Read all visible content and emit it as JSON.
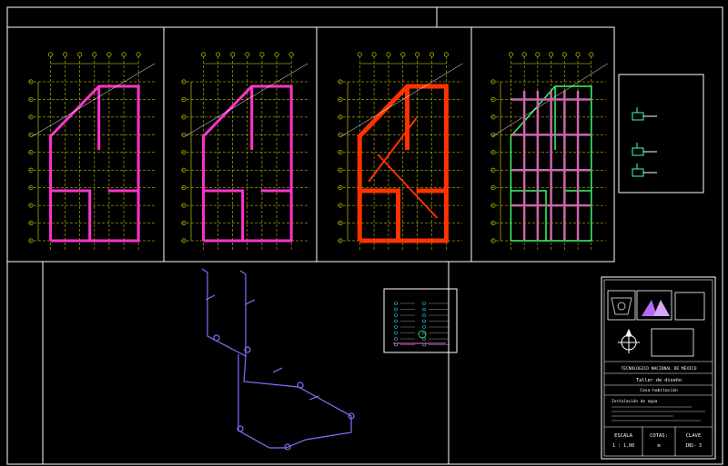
{
  "drawing": {
    "header_title": "",
    "panel_labels": [
      "",
      "",
      "",
      ""
    ],
    "detail_title": "",
    "legend_title": ""
  },
  "title_block": {
    "institution": "TECNOLOGICO NACIONAL DE MEXICO",
    "course": "Taller de diseño",
    "project": "Casa-habitación",
    "sheet_title": "Instalación de agua",
    "scale_label": "ESCALA",
    "scale_value": "1 : 1.00",
    "units_label": "COTAS:",
    "units_value": "m",
    "key_label": "CLAVE",
    "key_value": "INS- 3"
  },
  "colors": {
    "background": "#000000",
    "frame": "#ffffff",
    "grid": "#e6e600",
    "wall_magenta": "#ff33cc",
    "wall_red": "#ff3300",
    "pipe": "#8a6cff",
    "green": "#33ff66"
  }
}
